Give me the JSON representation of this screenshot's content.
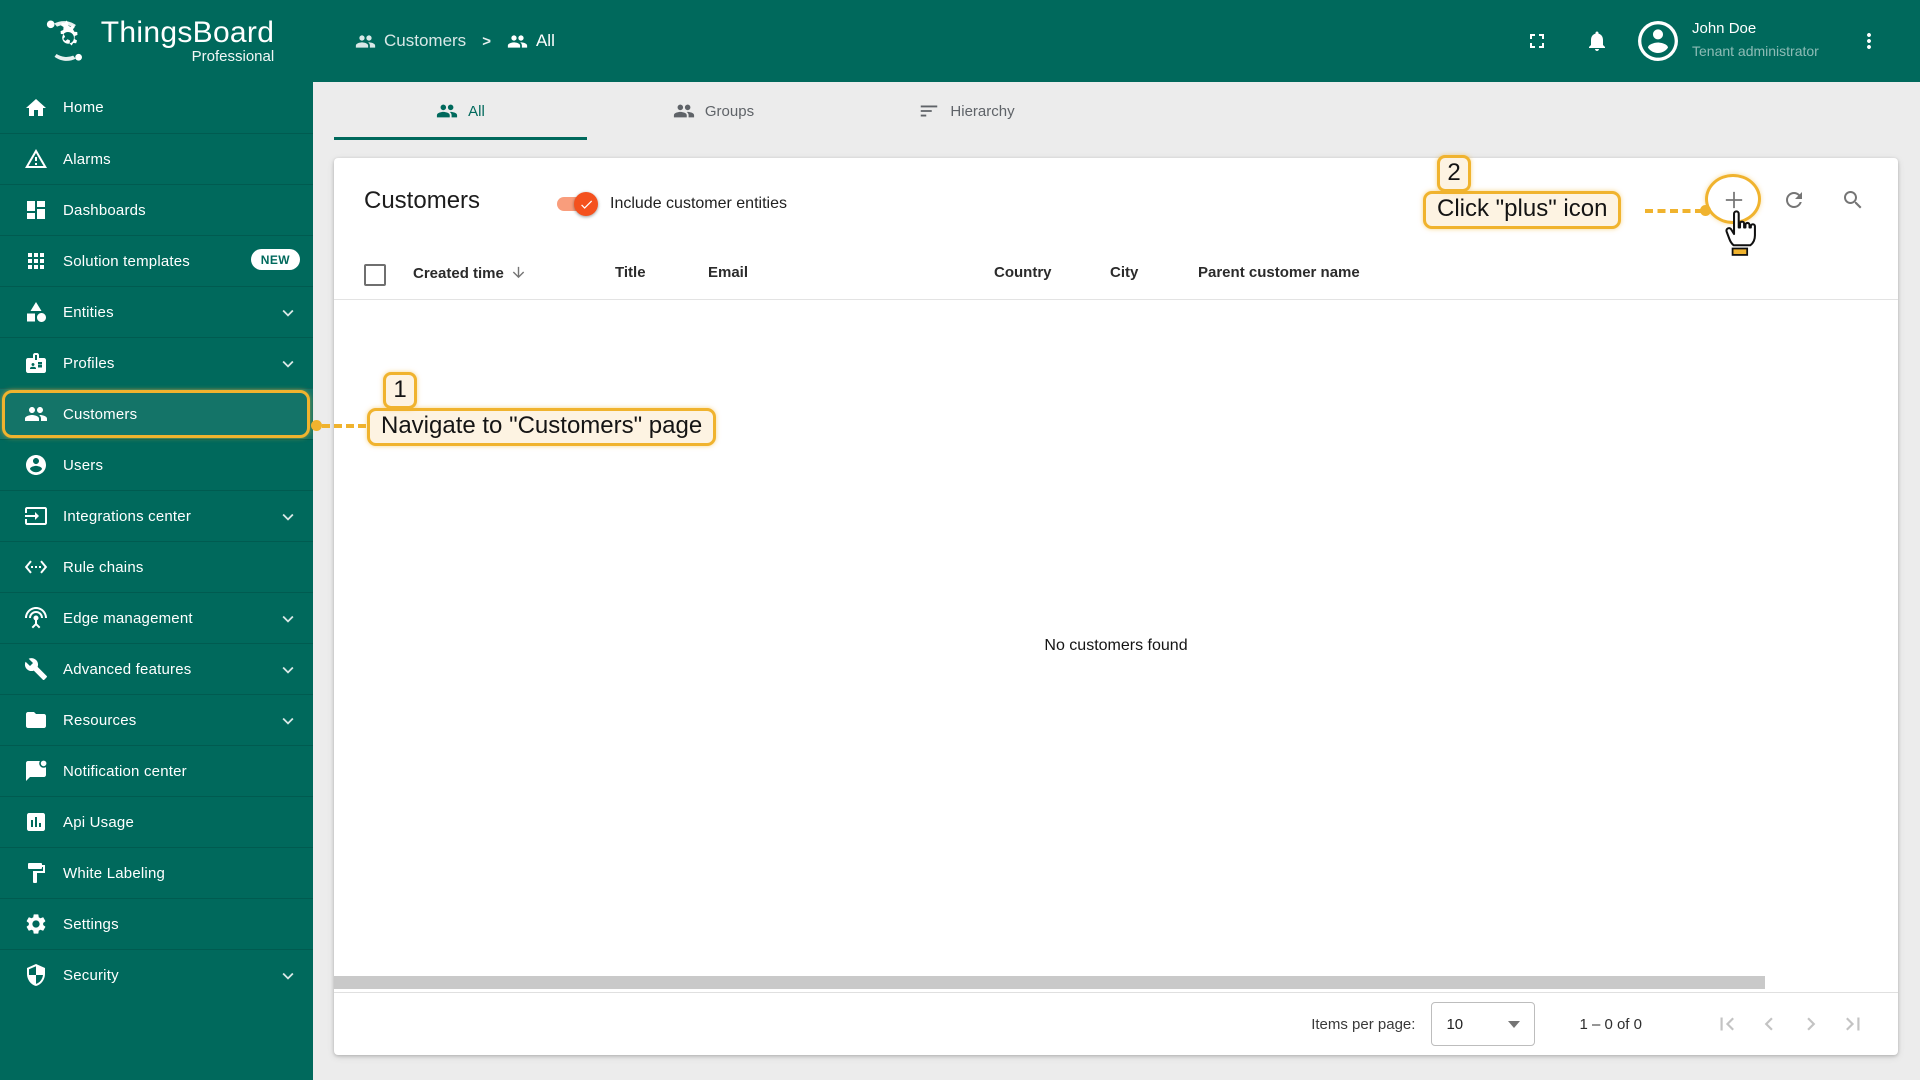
{
  "app": {
    "logo_title": "ThingsBoard",
    "logo_subtitle": "Professional"
  },
  "sidebar": {
    "items": [
      {
        "label": "Home",
        "icon": "home-icon"
      },
      {
        "label": "Alarms",
        "icon": "warning-icon"
      },
      {
        "label": "Dashboards",
        "icon": "dashboards-icon"
      },
      {
        "label": "Solution templates",
        "icon": "grid-icon",
        "badge": "NEW"
      },
      {
        "label": "Entities",
        "icon": "category-icon",
        "expandable": true
      },
      {
        "label": "Profiles",
        "icon": "badge-icon",
        "expandable": true
      },
      {
        "label": "Customers",
        "icon": "people-icon",
        "selected": true
      },
      {
        "label": "Users",
        "icon": "account-circle-icon"
      },
      {
        "label": "Integrations center",
        "icon": "input-icon",
        "expandable": true
      },
      {
        "label": "Rule chains",
        "icon": "ethernet-icon"
      },
      {
        "label": "Edge management",
        "icon": "antenna-icon",
        "expandable": true
      },
      {
        "label": "Advanced features",
        "icon": "tools-icon",
        "expandable": true
      },
      {
        "label": "Resources",
        "icon": "folder-icon",
        "expandable": true
      },
      {
        "label": "Notification center",
        "icon": "chat-dot-icon"
      },
      {
        "label": "Api Usage",
        "icon": "bar-chart-icon"
      },
      {
        "label": "White Labeling",
        "icon": "paint-roller-icon"
      },
      {
        "label": "Settings",
        "icon": "gear-icon"
      },
      {
        "label": "Security",
        "icon": "shield-icon",
        "expandable": true
      }
    ]
  },
  "header": {
    "breadcrumb": [
      {
        "label": "Customers"
      },
      {
        "label": "All"
      }
    ],
    "separator": ">",
    "user": {
      "name": "John Doe",
      "role": "Tenant administrator"
    }
  },
  "tabs": [
    {
      "label": "All",
      "active": true
    },
    {
      "label": "Groups",
      "active": false
    },
    {
      "label": "Hierarchy",
      "active": false
    }
  ],
  "main": {
    "title": "Customers",
    "toggle_label": "Include customer entities",
    "toggle_on": true,
    "table": {
      "columns": [
        {
          "label": "Created time",
          "sorted": "desc"
        },
        {
          "label": "Title"
        },
        {
          "label": "Email"
        },
        {
          "label": "Country"
        },
        {
          "label": "City"
        },
        {
          "label": "Parent customer name"
        }
      ],
      "empty_text": "No customers found"
    },
    "paginator": {
      "items_per_page_label": "Items per page:",
      "page_size": "10",
      "range": "1 – 0 of 0"
    }
  },
  "annotations": {
    "step1": {
      "number": "1",
      "text": "Navigate to \"Customers\" page"
    },
    "step2": {
      "number": "2",
      "text": "Click \"plus\" icon"
    }
  },
  "colors": {
    "primary_teal": "#00695c",
    "annotation_yellow": "#f0b32e",
    "annotation_fill": "#fdf3e2",
    "toggle_orange": "#f4511e"
  }
}
